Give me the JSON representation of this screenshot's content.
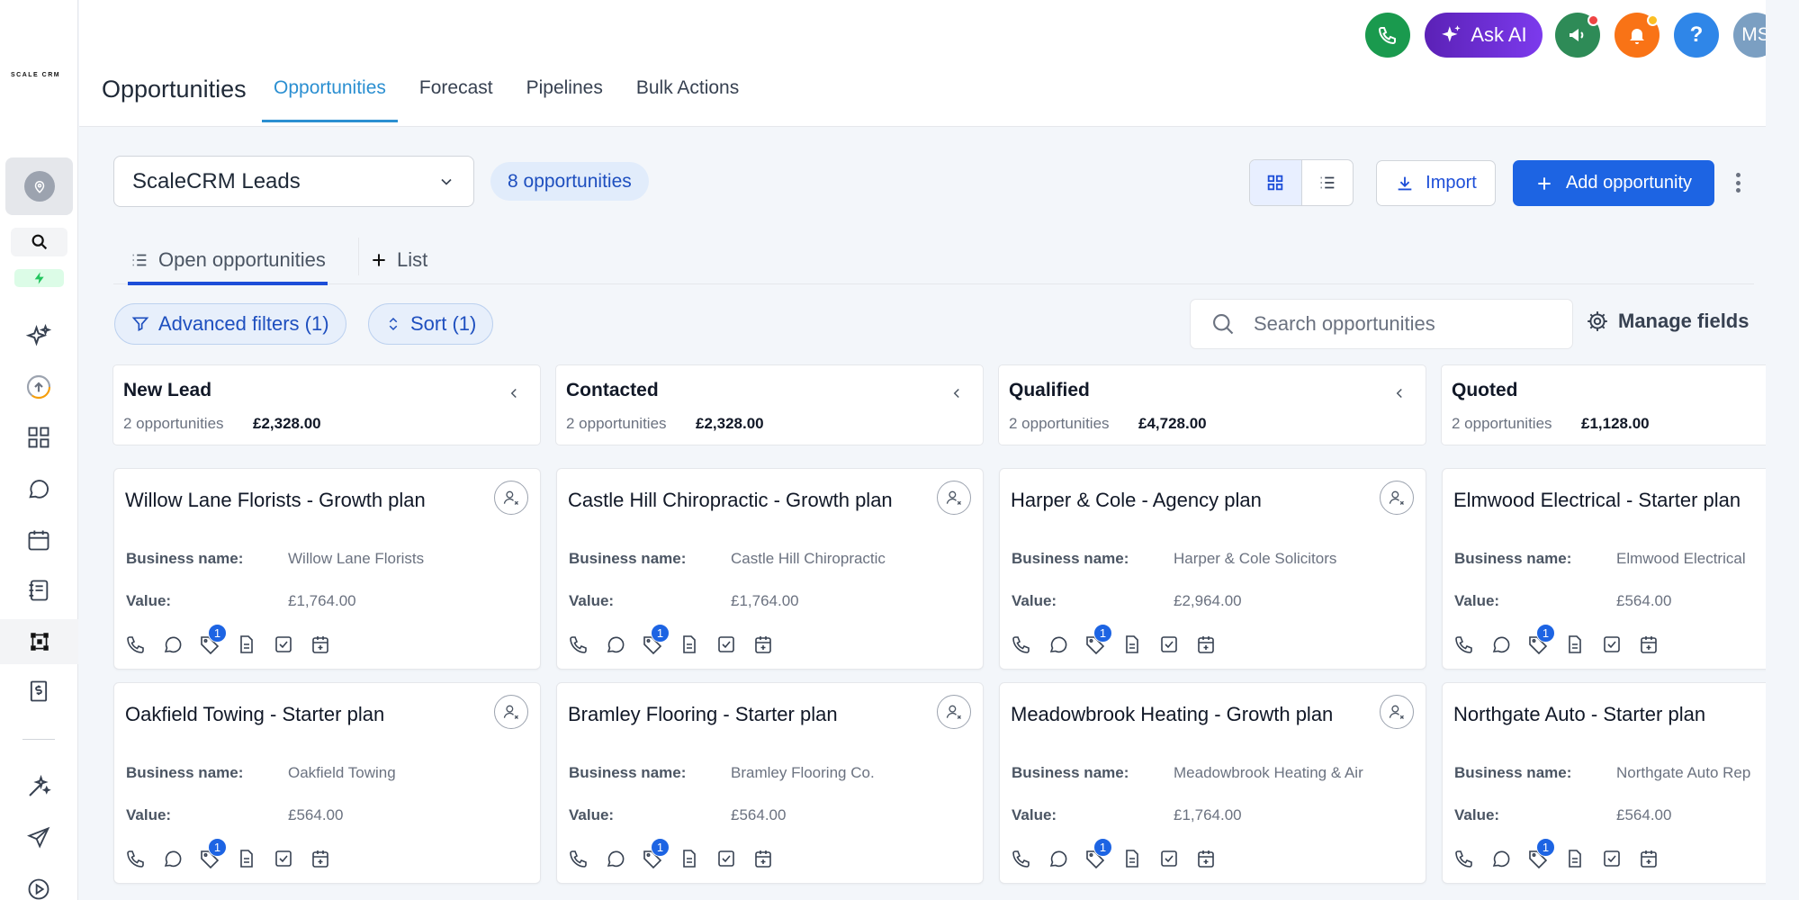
{
  "brand": {
    "logo_text": "SCALE CRM"
  },
  "header": {
    "page_title": "Opportunities",
    "tabs": [
      {
        "label": "Opportunities",
        "active": true
      },
      {
        "label": "Forecast"
      },
      {
        "label": "Pipelines"
      },
      {
        "label": "Bulk Actions"
      }
    ],
    "ask_ai_label": "Ask AI",
    "avatar_initials": "MS",
    "help_label": "?"
  },
  "sidebar": {
    "icons": [
      "location-pin-icon",
      "search-icon",
      "lightning-icon",
      "sparkles-icon",
      "upload-cloud-icon",
      "dashboard-icon",
      "chat-icon",
      "calendar-icon",
      "notebook-icon",
      "pipeline-icon",
      "dollar-doc-icon",
      "magic-wand-icon",
      "send-icon",
      "play-icon"
    ]
  },
  "toolbar": {
    "pipeline_selected": "ScaleCRM Leads",
    "opportunity_count": "8 opportunities",
    "import_label": "Import",
    "add_label": "Add opportunity"
  },
  "subtabs": {
    "open_label": "Open opportunities",
    "list_label": "List"
  },
  "filters": {
    "advanced_label": "Advanced filters (1)",
    "sort_label": "Sort (1)",
    "search_placeholder": "Search opportunities",
    "manage_label": "Manage fields"
  },
  "labels": {
    "business_name": "Business name:",
    "value": "Value:"
  },
  "columns": [
    {
      "name": "New Lead",
      "count": "2 opportunities",
      "amount": "£2,328.00",
      "cards": [
        {
          "title": "Willow Lane Florists - Growth plan",
          "business": "Willow Lane Florists",
          "value": "£1,764.00",
          "badge": "1"
        },
        {
          "title": "Oakfield Towing - Starter plan",
          "business": "Oakfield Towing",
          "value": "£564.00",
          "badge": "1"
        }
      ]
    },
    {
      "name": "Contacted",
      "count": "2 opportunities",
      "amount": "£2,328.00",
      "cards": [
        {
          "title": "Castle Hill Chiropractic - Growth plan",
          "business": "Castle Hill Chiropractic",
          "value": "£1,764.00",
          "badge": "1"
        },
        {
          "title": "Bramley Flooring - Starter plan",
          "business": "Bramley Flooring Co.",
          "value": "£564.00",
          "badge": "1"
        }
      ]
    },
    {
      "name": "Qualified",
      "count": "2 opportunities",
      "amount": "£4,728.00",
      "cards": [
        {
          "title": "Harper & Cole - Agency plan",
          "business": "Harper & Cole Solicitors",
          "value": "£2,964.00",
          "badge": "1"
        },
        {
          "title": "Meadowbrook Heating - Growth plan",
          "business": "Meadowbrook Heating & Air",
          "value": "£1,764.00",
          "badge": "1"
        }
      ]
    },
    {
      "name": "Quoted",
      "count": "2 opportunities",
      "amount": "£1,128.00",
      "cards": [
        {
          "title": "Elmwood Electrical - Starter plan",
          "business": "Elmwood Electrical",
          "value": "£564.00",
          "badge": "1"
        },
        {
          "title": "Northgate Auto - Starter plan",
          "business": "Northgate Auto Rep",
          "value": "£564.00",
          "badge": "1"
        }
      ]
    }
  ],
  "colors": {
    "accent": "#1d64e3",
    "tab_active": "#2b8fd1",
    "phone": "#16a34a",
    "bell": "#f97316",
    "help": "#3b82f6",
    "avatar": "#7b9fc2"
  }
}
